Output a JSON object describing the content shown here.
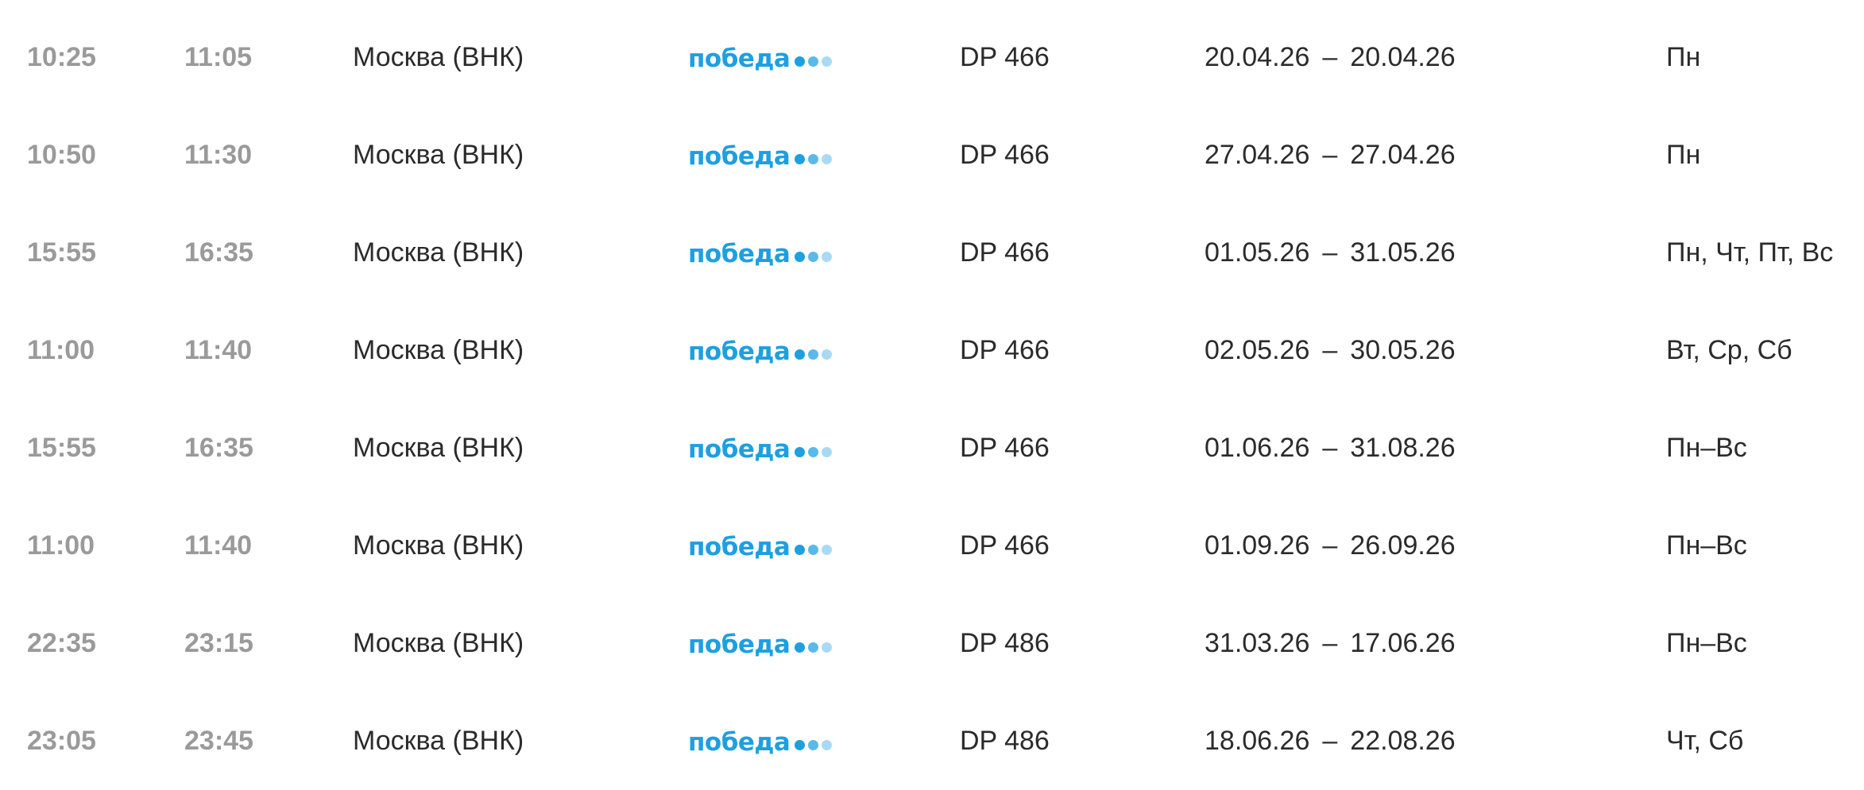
{
  "airline": {
    "logo_text": "победа",
    "dot_colors": [
      "#1e9fe0",
      "#5bb9ea",
      "#a9daf4"
    ]
  },
  "rows": [
    {
      "dep": "10:25",
      "arr": "11:05",
      "city": "Москва (ВНК)",
      "flight": "DP 466",
      "date_from": "20.04.26",
      "date_sep": "–",
      "date_to": "20.04.26",
      "days": "Пн"
    },
    {
      "dep": "10:50",
      "arr": "11:30",
      "city": "Москва (ВНК)",
      "flight": "DP 466",
      "date_from": "27.04.26",
      "date_sep": "–",
      "date_to": "27.04.26",
      "days": "Пн"
    },
    {
      "dep": "15:55",
      "arr": "16:35",
      "city": "Москва (ВНК)",
      "flight": "DP 466",
      "date_from": "01.05.26",
      "date_sep": "–",
      "date_to": "31.05.26",
      "days": "Пн, Чт, Пт, Вс"
    },
    {
      "dep": "11:00",
      "arr": "11:40",
      "city": "Москва (ВНК)",
      "flight": "DP 466",
      "date_from": "02.05.26",
      "date_sep": "–",
      "date_to": "30.05.26",
      "days": "Вт, Ср, Сб"
    },
    {
      "dep": "15:55",
      "arr": "16:35",
      "city": "Москва (ВНК)",
      "flight": "DP 466",
      "date_from": "01.06.26",
      "date_sep": "–",
      "date_to": "31.08.26",
      "days": "Пн–Вс"
    },
    {
      "dep": "11:00",
      "arr": "11:40",
      "city": "Москва (ВНК)",
      "flight": "DP 466",
      "date_from": "01.09.26",
      "date_sep": "–",
      "date_to": "26.09.26",
      "days": "Пн–Вс"
    },
    {
      "dep": "22:35",
      "arr": "23:15",
      "city": "Москва (ВНК)",
      "flight": "DP 486",
      "date_from": "31.03.26",
      "date_sep": "–",
      "date_to": "17.06.26",
      "days": "Пн–Вс"
    },
    {
      "dep": "23:05",
      "arr": "23:45",
      "city": "Москва (ВНК)",
      "flight": "DP 486",
      "date_from": "18.06.26",
      "date_sep": "–",
      "date_to": "22.08.26",
      "days": "Чт, Сб"
    }
  ]
}
